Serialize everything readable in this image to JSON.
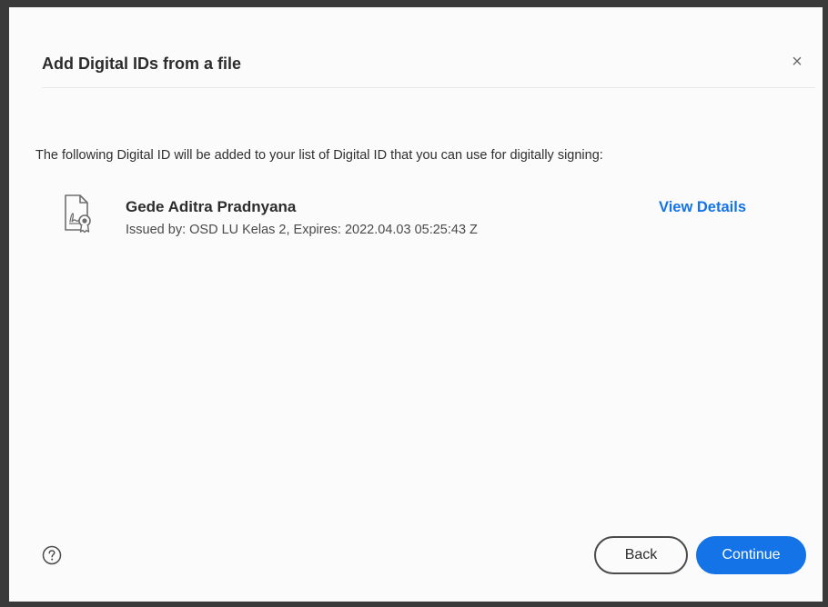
{
  "dialog": {
    "title": "Add Digital IDs from a file",
    "close_glyph": "×",
    "intro_text": "The following Digital ID will be added to your list of Digital ID that you can use for digitally signing:",
    "certificate": {
      "icon": "certificate-file-icon",
      "name": "Gede Aditra Pradnyana",
      "issued": "Issued by: OSD LU Kelas 2, Expires: 2022.04.03 05:25:43 Z",
      "view_details_label": "View Details"
    },
    "footer": {
      "help_icon": "help-circle-icon",
      "back_label": "Back",
      "continue_label": "Continue"
    }
  },
  "colors": {
    "accent": "#1473e6",
    "frame": "#3a3a3a",
    "dialog_bg": "#fbfbfb"
  }
}
